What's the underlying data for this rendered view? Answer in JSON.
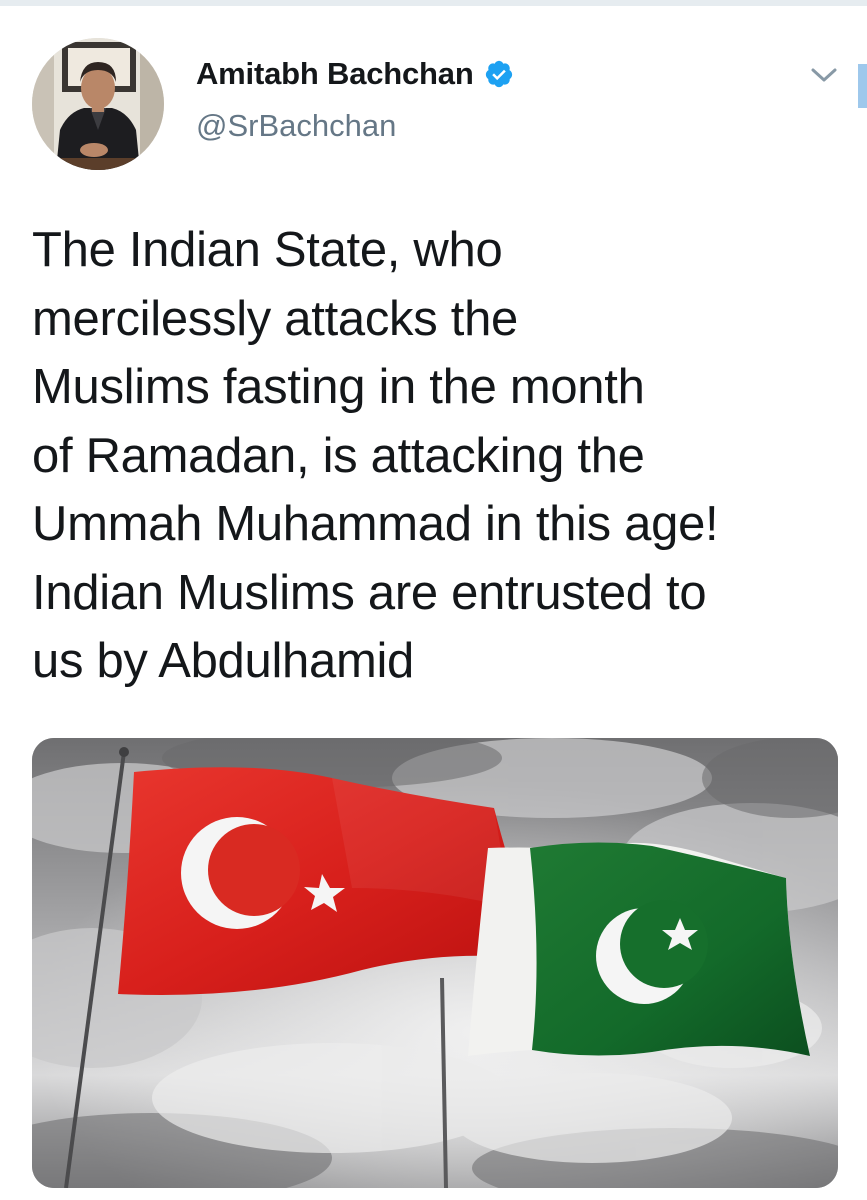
{
  "tweet": {
    "author": {
      "display_name": "Amitabh Bachchan",
      "handle": "@SrBachchan",
      "verified": true,
      "verified_icon": "verified-badge-icon",
      "avatar": "profile-photo-avatar"
    },
    "menu_icon": "chevron-down-icon",
    "text": "The Indian State, who\nmercilessly attacks the\nMuslims fasting in the month\nof Ramadan, is attacking the\nUmmah Muhammad in this age!\nIndian Muslims are entrusted to\nus by Abdulhamid",
    "media": {
      "type": "image",
      "depicts": "turkey-and-pakistan-flags"
    }
  },
  "colors": {
    "verified_blue": "#1da1f2",
    "name_text": "#14171a",
    "handle_text": "#657786",
    "turkey_red": "#e30a17",
    "pakistan_green": "#01411c"
  }
}
